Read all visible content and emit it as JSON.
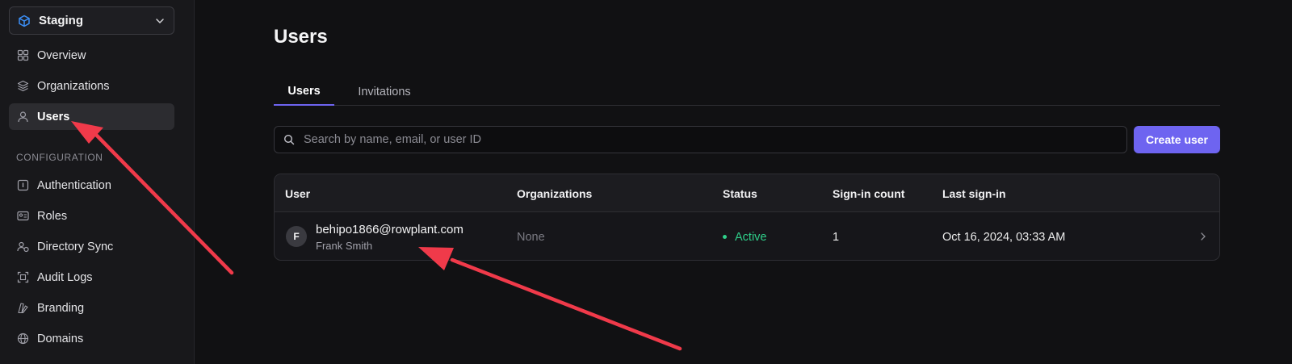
{
  "environment": {
    "label": "Staging"
  },
  "nav": {
    "items": [
      {
        "label": "Overview"
      },
      {
        "label": "Organizations"
      },
      {
        "label": "Users"
      }
    ],
    "section_label": "CONFIGURATION",
    "config_items": [
      {
        "label": "Authentication"
      },
      {
        "label": "Roles"
      },
      {
        "label": "Directory Sync"
      },
      {
        "label": "Audit Logs"
      },
      {
        "label": "Branding"
      },
      {
        "label": "Domains"
      }
    ]
  },
  "main": {
    "title": "Users",
    "tabs": [
      {
        "label": "Users"
      },
      {
        "label": "Invitations"
      }
    ],
    "search": {
      "placeholder": "Search by name, email, or user ID",
      "value": ""
    },
    "create_button": "Create user",
    "table": {
      "columns": [
        "User",
        "Organizations",
        "Status",
        "Sign-in count",
        "Last sign-in"
      ],
      "rows": [
        {
          "avatar_initial": "F",
          "email": "behipo1866@rowplant.com",
          "name": "Frank Smith",
          "organizations": "None",
          "status": "Active",
          "sign_in_count": "1",
          "last_sign_in": "Oct 16, 2024, 03:33 AM"
        }
      ]
    }
  },
  "colors": {
    "accent": "#6e64f0",
    "status_active": "#2fcf8a",
    "annotation_arrow": "#f03a4a"
  }
}
